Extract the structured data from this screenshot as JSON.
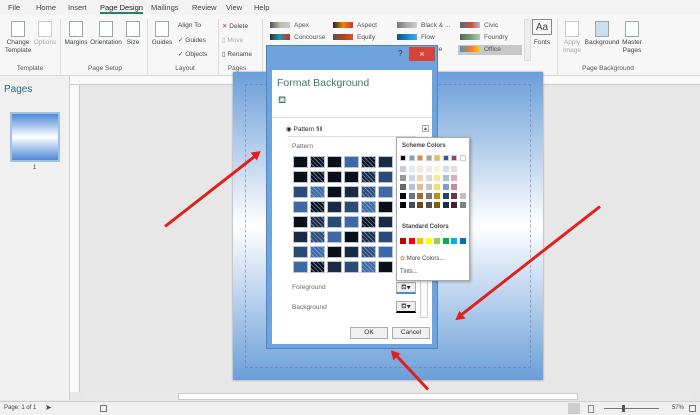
{
  "tabs": [
    "File",
    "Home",
    "Insert",
    "Page Design",
    "Mailings",
    "Review",
    "View",
    "Help"
  ],
  "ribbon": {
    "change_template": "Change Template",
    "options": "Options",
    "margins": "Margins",
    "orientation": "Orientation",
    "size": "Size",
    "guides": "Guides",
    "align_to": "Align To",
    "guides_check": "Guides",
    "objects_check": "Objects",
    "delete": "Delete",
    "move": "Move",
    "rename": "Rename",
    "themes": [
      "Apex",
      "Concourse",
      "Aspect",
      "Equity",
      "Black & ...",
      "Flow",
      "Module",
      "Civic",
      "Foundry",
      "Office"
    ],
    "fonts": "Fonts",
    "fonts_icon": "Aa",
    "apply_image": "Apply Image",
    "background": "Background",
    "master_pages": "Master Pages",
    "groups": [
      "Template",
      "Page Setup",
      "Layout",
      "Pages",
      "Page Background"
    ]
  },
  "pages_panel": {
    "title": "Pages",
    "page_number": "1"
  },
  "dialog": {
    "title": "Format Background",
    "help": "?",
    "close": "×",
    "fill_option": "Pattern fill",
    "pattern_label": "Pattern",
    "foreground_label": "Foreground",
    "background_label": "Background",
    "ok": "OK",
    "cancel": "Cancel"
  },
  "color_popup": {
    "scheme_title": "Scheme Colors",
    "standard_title": "Standard Colors",
    "more_colors": "More Colors...",
    "tints": "Tints...",
    "scheme": [
      "#000000",
      "#7f9cc0",
      "#e08a3c",
      "#a0a0a0",
      "#f2c314",
      "#2a5d9a",
      "#a03a6a",
      "#ffffff"
    ],
    "standard": [
      "#c00000",
      "#ff0000",
      "#ffc000",
      "#ffff00",
      "#92d050",
      "#00b050",
      "#00b0f0",
      "#0070c0"
    ]
  },
  "status": {
    "page": "Page: 1 of 1",
    "zoom": "57%"
  }
}
